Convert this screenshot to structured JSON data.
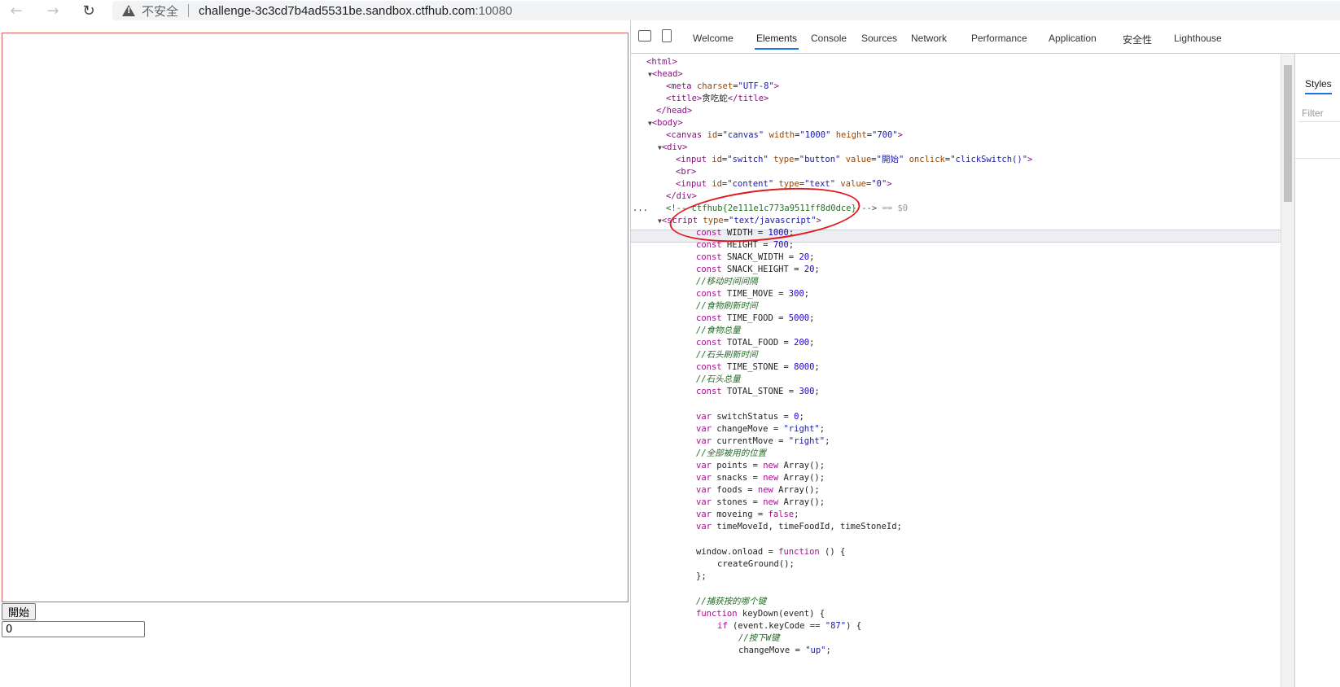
{
  "browser": {
    "insecure_label": "不安全",
    "url_host": "challenge-3c3cd7b4ad5531be.sandbox.ctfhub.com",
    "url_port": ":10080"
  },
  "page": {
    "start_button": "開始",
    "content_value": "0"
  },
  "devtools": {
    "tabs": [
      "Welcome",
      "Elements",
      "Console",
      "Sources",
      "Network",
      "Performance",
      "Application",
      "安全性",
      "Lighthouse"
    ],
    "active_tab": "Elements",
    "styles_tab": "Styles",
    "filter_placeholder": "Filter",
    "selected_marker": "== $0",
    "ellipsis": "..."
  },
  "source": {
    "title_text": "贪吃蛇",
    "flag_comment": "<!-- ctfhub{2e111e1c773a9511ff8d0dce} -->",
    "canvas_id": "canvas",
    "canvas_width": "1000",
    "canvas_height": "700",
    "switch_value": "開始",
    "js": {
      "width": "1000",
      "height": "700",
      "snack_w": "20",
      "snack_h": "20",
      "c_move": "//移动时间间隔",
      "time_move": "300",
      "c_food": "//食物刷新时间",
      "time_food": "5000",
      "c_food_total": "//食物总量",
      "total_food": "200",
      "c_stone": "//石头刷新时间",
      "time_stone": "8000",
      "c_stone_total": "//石头总量",
      "total_stone": "300",
      "c_pos": "//全部被用的位置",
      "c_key": "//捕获按的哪个键",
      "c_w": "//按下W键",
      "keycode": "\"87\""
    }
  }
}
